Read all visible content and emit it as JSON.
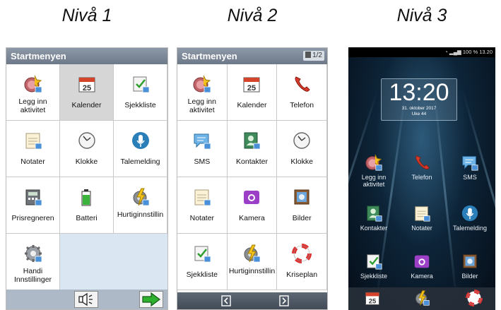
{
  "levels": [
    {
      "title": "Nivå 1"
    },
    {
      "title": "Nivå 2"
    },
    {
      "title": "Nivå 3"
    }
  ],
  "level1": {
    "header": "Startmenyen",
    "tiles": [
      {
        "label": "Legg inn aktivitet",
        "icon": "add-activity-icon"
      },
      {
        "label": "Kalender",
        "icon": "calendar-icon",
        "selected": true
      },
      {
        "label": "Sjekkliste",
        "icon": "checklist-icon"
      },
      {
        "label": "Notater",
        "icon": "notes-icon"
      },
      {
        "label": "Klokke",
        "icon": "clock-icon"
      },
      {
        "label": "Talemelding",
        "icon": "microphone-icon"
      },
      {
        "label": "Prisregneren",
        "icon": "calculator-icon"
      },
      {
        "label": "Batteri",
        "icon": "battery-icon"
      },
      {
        "label": "Hurtiginnstillin",
        "icon": "quick-settings-icon"
      },
      {
        "label": "Handi Innstillinger",
        "icon": "settings-gear-icon"
      }
    ]
  },
  "level2": {
    "header": "Startmenyen",
    "page_indicator": "1/2",
    "tiles": [
      {
        "label": "Legg inn aktivitet",
        "icon": "add-activity-icon"
      },
      {
        "label": "Kalender",
        "icon": "calendar-icon"
      },
      {
        "label": "Telefon",
        "icon": "phone-icon"
      },
      {
        "label": "SMS",
        "icon": "sms-icon"
      },
      {
        "label": "Kontakter",
        "icon": "contacts-icon"
      },
      {
        "label": "Klokke",
        "icon": "clock-icon"
      },
      {
        "label": "Notater",
        "icon": "notes-icon"
      },
      {
        "label": "Kamera",
        "icon": "camera-icon"
      },
      {
        "label": "Bilder",
        "icon": "pictures-icon"
      },
      {
        "label": "Sjekkliste",
        "icon": "checklist-icon"
      },
      {
        "label": "Hurtiginnstillin",
        "icon": "quick-settings-icon"
      },
      {
        "label": "Kriseplan",
        "icon": "lifebuoy-icon"
      }
    ]
  },
  "level3": {
    "status": "100 %  13.20",
    "clock_time": "13:20",
    "clock_date": "31. oktober 2017",
    "clock_week": "Uke 44",
    "apps": [
      {
        "label": "Legg inn aktivitet",
        "icon": "add-activity-icon"
      },
      {
        "label": "Telefon",
        "icon": "phone-icon"
      },
      {
        "label": "SMS",
        "icon": "sms-icon"
      },
      {
        "label": "Kontakter",
        "icon": "contacts-icon"
      },
      {
        "label": "Notater",
        "icon": "notes-icon"
      },
      {
        "label": "Talemelding",
        "icon": "microphone-icon"
      },
      {
        "label": "Sjekkliste",
        "icon": "checklist-icon"
      },
      {
        "label": "Kamera",
        "icon": "camera-icon"
      },
      {
        "label": "Bilder",
        "icon": "pictures-icon"
      }
    ],
    "dock": [
      {
        "icon": "calendar-icon"
      },
      {
        "icon": "quick-settings-icon"
      },
      {
        "icon": "lifebuoy-icon"
      }
    ]
  }
}
